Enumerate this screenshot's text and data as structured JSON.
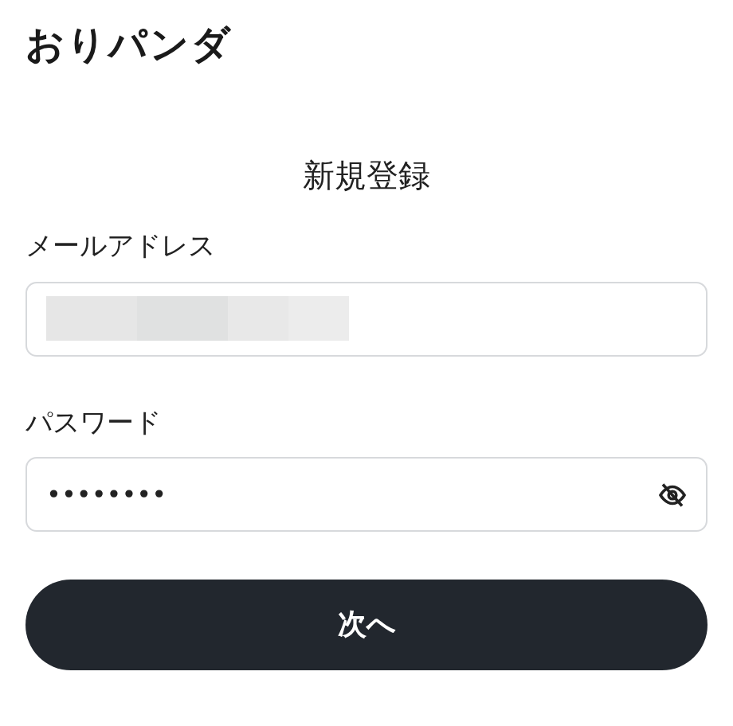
{
  "logo": {
    "text": "おりパンダ"
  },
  "title": "新規登録",
  "fields": [
    {
      "label": "メールアドレス",
      "kind": "email",
      "value_redacted": true
    },
    {
      "label": "パスワード",
      "kind": "password",
      "value": "••••••••",
      "revealed": false
    }
  ],
  "submit_button": {
    "label": "次へ"
  }
}
